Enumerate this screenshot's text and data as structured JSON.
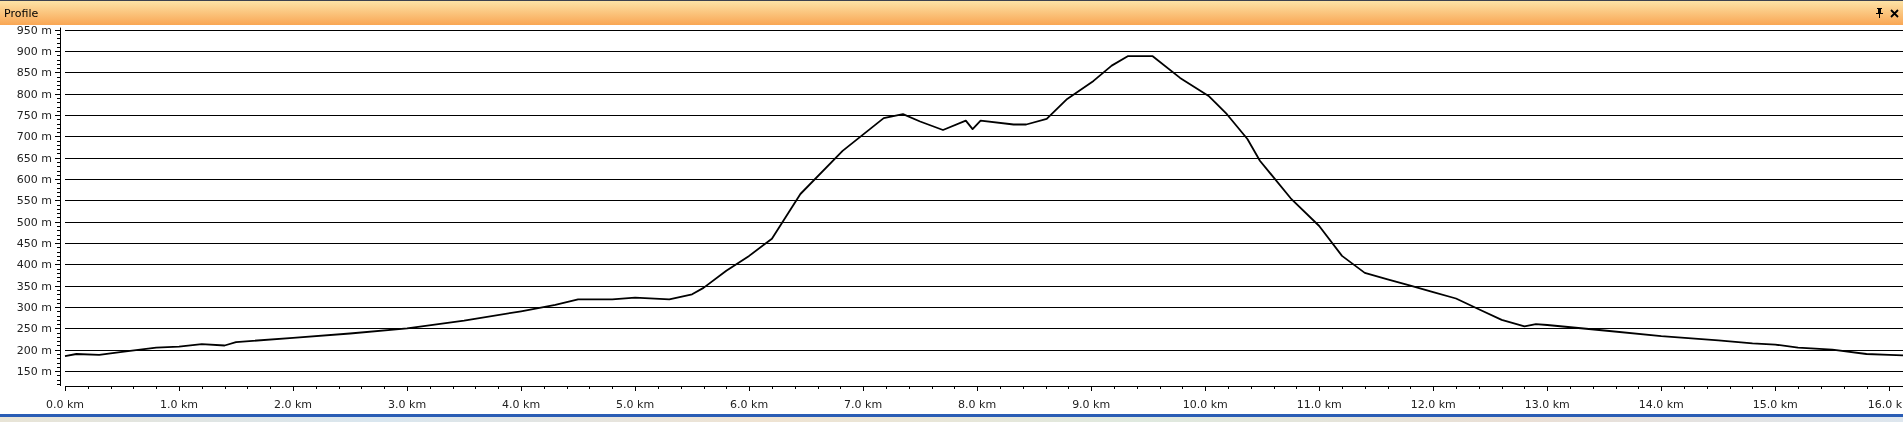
{
  "panel": {
    "title": "Profile",
    "buttons": [
      {
        "kind": "pin"
      },
      {
        "kind": "close"
      }
    ]
  },
  "chart_data": {
    "type": "line",
    "grid": true,
    "xlim": [
      0,
      16.12
    ],
    "ylim": [
      115,
      955
    ],
    "xticks": [
      {
        "value": 0,
        "label": "0.0 km"
      },
      {
        "value": 1,
        "label": "1.0 km"
      },
      {
        "value": 2,
        "label": "2.0 km"
      },
      {
        "value": 3,
        "label": "3.0 km"
      },
      {
        "value": 4,
        "label": "4.0 km"
      },
      {
        "value": 5,
        "label": "5.0 km"
      },
      {
        "value": 6,
        "label": "6.0 km"
      },
      {
        "value": 7,
        "label": "7.0 km"
      },
      {
        "value": 8,
        "label": "8.0 km"
      },
      {
        "value": 9,
        "label": "9.0 km"
      },
      {
        "value": 10,
        "label": "10.0 km"
      },
      {
        "value": 11,
        "label": "11.0 km"
      },
      {
        "value": 12,
        "label": "12.0 km"
      },
      {
        "value": 13,
        "label": "13.0 km"
      },
      {
        "value": 14,
        "label": "14.0 km"
      },
      {
        "value": 15,
        "label": "15.0 km"
      },
      {
        "value": 16,
        "label": "16.0 k"
      }
    ],
    "yticks": [
      {
        "value": 150,
        "label": "150 m"
      },
      {
        "value": 200,
        "label": "200 m"
      },
      {
        "value": 250,
        "label": "250 m"
      },
      {
        "value": 300,
        "label": "300 m"
      },
      {
        "value": 350,
        "label": "350 m"
      },
      {
        "value": 400,
        "label": "400 m"
      },
      {
        "value": 450,
        "label": "450 m"
      },
      {
        "value": 500,
        "label": "500 m"
      },
      {
        "value": 550,
        "label": "550 m"
      },
      {
        "value": 600,
        "label": "600 m"
      },
      {
        "value": 650,
        "label": "650 m"
      },
      {
        "value": 700,
        "label": "700 m"
      },
      {
        "value": 750,
        "label": "750 m"
      },
      {
        "value": 800,
        "label": "800 m"
      },
      {
        "value": 850,
        "label": "850 m"
      },
      {
        "value": 900,
        "label": "900 m"
      },
      {
        "value": 950,
        "label": "950 m"
      }
    ],
    "x": [
      0,
      0.1,
      0.3,
      0.5,
      0.8,
      1.0,
      1.2,
      1.4,
      1.5,
      2.0,
      2.5,
      3.0,
      3.5,
      4.0,
      4.3,
      4.5,
      4.8,
      5.0,
      5.3,
      5.5,
      5.6,
      5.8,
      6.0,
      6.2,
      6.45,
      6.82,
      7.18,
      7.35,
      7.5,
      7.7,
      7.9,
      7.96,
      8.03,
      8.32,
      8.43,
      8.61,
      8.79,
      9.02,
      9.18,
      9.32,
      9.54,
      9.78,
      10.03,
      10.19,
      10.37,
      10.48,
      10.75,
      11.0,
      11.2,
      11.4,
      11.6,
      11.8,
      12.0,
      12.2,
      12.4,
      12.6,
      12.8,
      12.9,
      13.0,
      13.5,
      14.0,
      14.5,
      14.8,
      15.0,
      15.2,
      15.5,
      15.8,
      16.0,
      16.12
    ],
    "series": [
      {
        "color": "#000000",
        "values": [
          185,
          190,
          188,
          195,
          205,
          207,
          213,
          210,
          218,
          228,
          238,
          250,
          268,
          290,
          305,
          318,
          318,
          322,
          318,
          330,
          345,
          385,
          420,
          460,
          565,
          666,
          743,
          752,
          735,
          715,
          737,
          717,
          737,
          728,
          728,
          741,
          788,
          830,
          866,
          888,
          888,
          837,
          795,
          752,
          694,
          643,
          555,
          490,
          420,
          380,
          365,
          350,
          335,
          320,
          295,
          270,
          255,
          260,
          258,
          245,
          232,
          222,
          215,
          212,
          205,
          200,
          190,
          188,
          187
        ]
      }
    ]
  }
}
